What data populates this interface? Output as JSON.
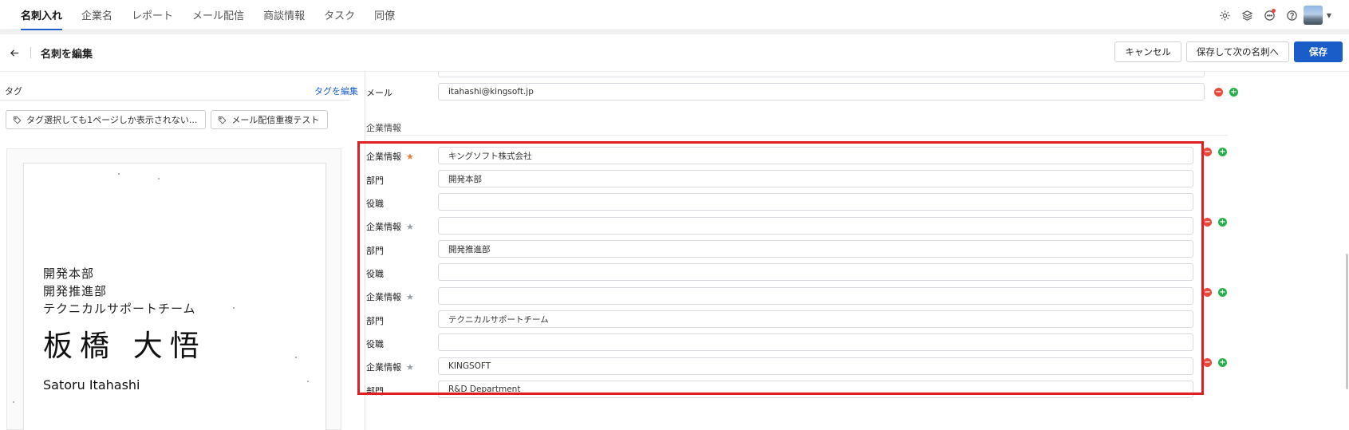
{
  "nav": {
    "tabs": [
      {
        "label": "名刺入れ",
        "active": true
      },
      {
        "label": "企業名"
      },
      {
        "label": "レポート"
      },
      {
        "label": "メール配信"
      },
      {
        "label": "商談情報"
      },
      {
        "label": "タスク"
      },
      {
        "label": "同僚"
      }
    ],
    "icons": [
      "gear-icon",
      "layers-icon",
      "chat-icon",
      "help-icon"
    ],
    "accent_color": "#1a5dc8"
  },
  "header": {
    "title": "名刺を編集",
    "cancel_label": "キャンセル",
    "save_next_label": "保存して次の名刺へ",
    "save_label": "保存"
  },
  "tags": {
    "label": "タグ",
    "edit_label": "タグを編集",
    "items": [
      "タグ選択しても1ページしか表示されない...",
      "メール配信重複テスト"
    ]
  },
  "card_image": {
    "lines": [
      "開発本部",
      "開発推進部",
      "テクニカルサポートチーム"
    ],
    "name": "板橋 大悟",
    "roman_name": "Satoru Itahashi"
  },
  "form": {
    "email_label": "メール",
    "email_value": "itahashi@kingsoft.jp",
    "section_title": "企業情報",
    "company_label": "企業情報",
    "department_label": "部門",
    "title_label": "役職",
    "entries": [
      {
        "company": "キングソフト株式会社",
        "department": "開発本部",
        "title": "",
        "primary": true
      },
      {
        "company": "",
        "department": "開発推進部",
        "title": "",
        "primary": false
      },
      {
        "company": "",
        "department": "テクニカルサポートチーム",
        "title": "",
        "primary": false
      },
      {
        "company": "KINGSOFT",
        "department": "R&D Department",
        "title": "",
        "primary": false
      }
    ],
    "star_primary_color": "#f07a2c",
    "star_default_color": "#9aa0a6"
  }
}
